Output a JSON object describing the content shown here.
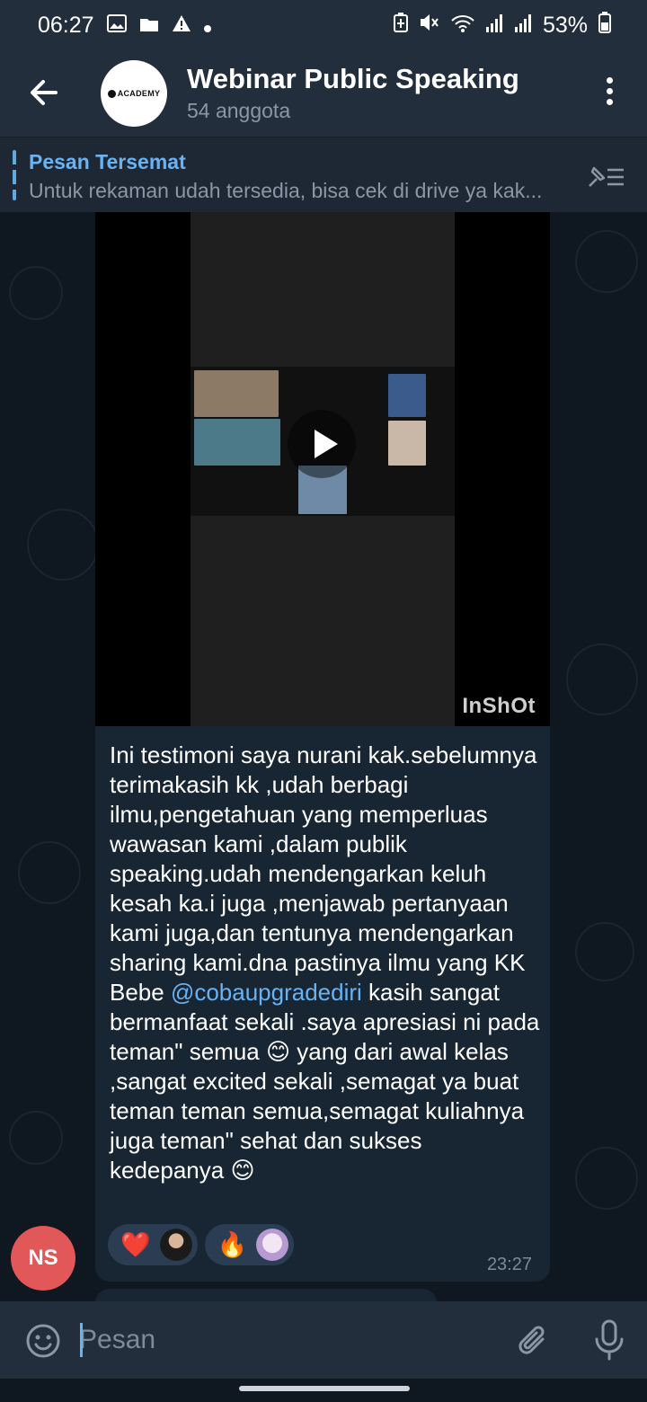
{
  "status_bar": {
    "time": "06:27",
    "battery": "53%",
    "icons": [
      "gallery-icon",
      "folder-icon",
      "alert-icon",
      "dot-icon",
      "battery-saver-icon",
      "mute-icon",
      "wifi-icon",
      "signal-icon",
      "signal-icon",
      "battery-icon"
    ]
  },
  "header": {
    "title": "Webinar Public Speaking",
    "subtitle": "54 anggota",
    "avatar_text": "ACADEMY"
  },
  "pinned": {
    "title": "Pesan Tersemat",
    "text": "Untuk rekaman udah tersedia, bisa cek di drive ya kak..."
  },
  "message": {
    "video_watermark": "InShOt",
    "text_before_mention": "Ini testimoni saya nurani kak.sebelumnya terimakasih kk ,udah berbagi ilmu,pengetahuan yang memperluas wawasan kami ,dalam publik speaking.udah mendengarkan keluh kesah ka.i juga ,menjawab pertanyaan kami juga,dan tentunya mendengarkan sharing kami.dna pastinya ilmu yang KK Bebe ",
    "mention": "@cobaupgradediri",
    "text_after_mention": " kasih sangat bermanfaat sekali .saya apresiasi ni pada teman\" semua 😊 yang dari awal kelas ,sangat excited sekali ,semagat ya buat teman teman semua,semagat kuliahnya juga teman\" sehat dan sukses kedepanya 😊",
    "reactions": [
      {
        "emoji": "❤️",
        "icon": "heart-icon"
      },
      {
        "emoji": "🔥",
        "icon": "fire-icon"
      }
    ],
    "time": "23:27",
    "sender_initials": "NS"
  },
  "composer": {
    "placeholder": "Pesan"
  },
  "colors": {
    "accent": "#6ab3f3",
    "header_bg": "#232e3c",
    "bubble_bg": "#182533",
    "sender_avatar": "#e25757"
  }
}
